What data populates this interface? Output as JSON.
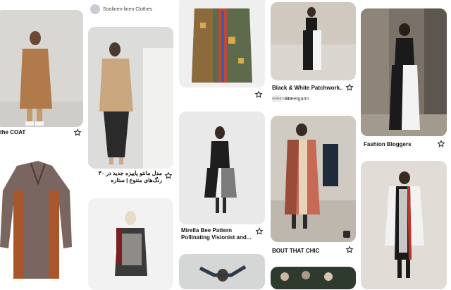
{
  "pins": {
    "c1a": {
      "title": "the COAT"
    },
    "c2a": {
      "title": "مدل مانتو پاییزه جدید در ۳۰ رنگ‌های متنوع | ستاره"
    },
    "c2top": {
      "source": "Soolinen-linen Clothes"
    },
    "c3b": {
      "title": "Mirella Bee Pattern Pollinating Visionist and..."
    },
    "c4a": {
      "title": "Black & White Patchwork...",
      "source": "Streetgarm",
      "source_logo": "STREETGARM"
    },
    "c4b": {
      "title": "BOUT THAT CHIC"
    },
    "c5a": {
      "title": "Fashion Bloggers"
    }
  },
  "icons": {
    "save": "star-outline-icon",
    "badge": "square-badge-icon"
  }
}
